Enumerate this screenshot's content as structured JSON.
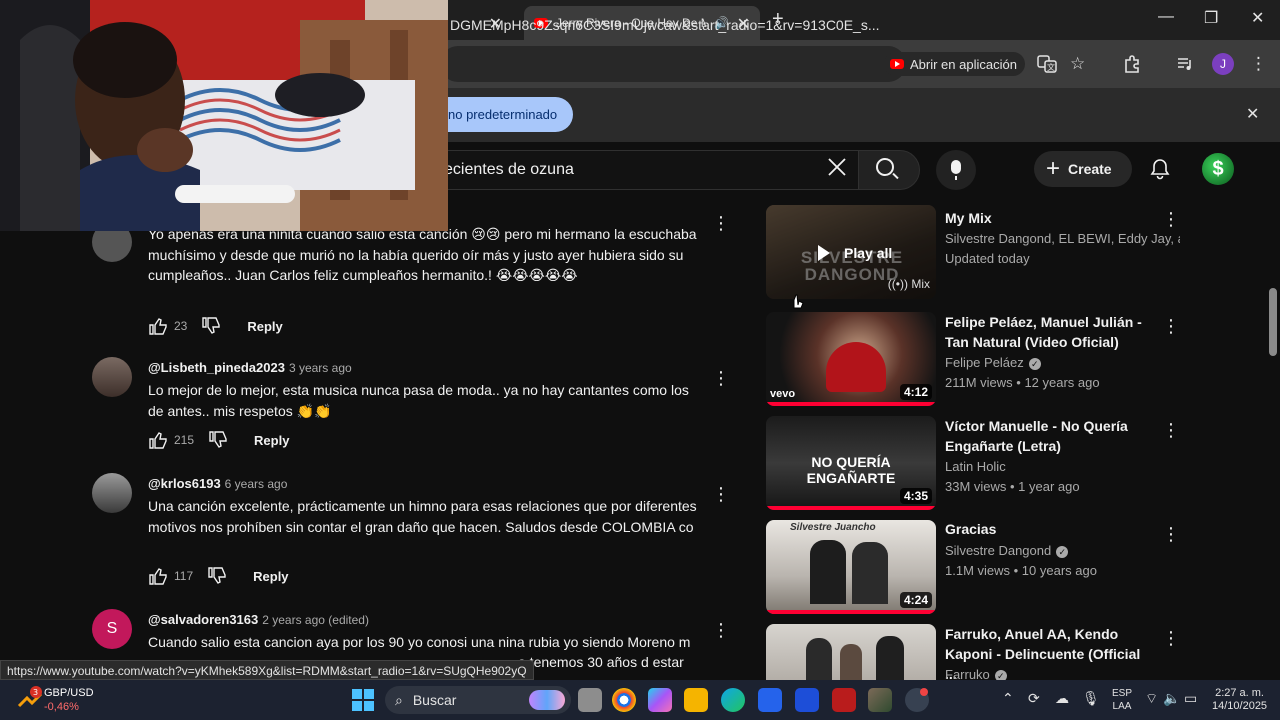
{
  "browser": {
    "tabs": [
      {
        "title": "",
        "active": false
      },
      {
        "title": "Jerry Rivera - Que Hay De Mal",
        "active": true
      }
    ],
    "url": "DGMEMpH8c9Zsqn6C3SI9mUjwcaw&start_radio=1&rv=913C0E_s...",
    "open_in_app_label": "Abrir en aplicación",
    "profile_letter": "J",
    "infobar_button": "no predeterminado",
    "status_url": "https://www.youtube.com/watch?v=yKMhek589Xg&list=RDMM&start_radio=1&rv=SUgQHe902yQ"
  },
  "youtube": {
    "search_query": "ecientes de ozuna",
    "create_label": "Create",
    "avatar_letter": "$"
  },
  "comments": [
    {
      "author": "",
      "time": "",
      "text": "Yo apenas era una niñita cuando salio esta canción 😢😢 pero mi hermano la escuchaba muchísimo y desde que murió no la había querido oír más y justo ayer hubiera sido su cumpleaños.. Juan Carlos feliz cumpleaños hermanito.! 😭😭😭😭😭",
      "likes": "23",
      "reply_label": "Reply"
    },
    {
      "author": "@Lisbeth_pineda2023",
      "time": "3 years ago",
      "text": "Lo mejor de lo mejor, esta musica nunca pasa de moda.. ya no hay cantantes como los de antes.. mis respetos 👏👏",
      "likes": "215",
      "reply_label": "Reply"
    },
    {
      "author": "@krlos6193",
      "time": "6 years ago",
      "text": "Una canción excelente, prácticamente un himno para esas relaciones que por diferentes motivos nos prohíben sin contar el gran daño que hacen. Saludos desde COLOMBIA co",
      "likes": "117",
      "reply_label": "Reply"
    },
    {
      "author": "@salvadoren3163",
      "time": "2 years ago (edited)",
      "avatar_letter": "S",
      "text": "Cuando salio esta cancion aya por los 90 yo conosi una nina rubia yo siendo Moreno m",
      "text2": "a tenemos 30 años d estar"
    }
  ],
  "sidebar": [
    {
      "title": "My Mix",
      "meta1": "Silvestre Dangond, EL BEWI, Eddy Jay, an...",
      "meta2": "Updated today",
      "play_all": "Play all",
      "mix_label": "Mix",
      "thumb_text": "SILVESTRE DANGOND"
    },
    {
      "title": "Felipe Peláez, Manuel Julián - Tan Natural (Video Oficial)",
      "channel": "Felipe Peláez",
      "stats": "211M views • 12 years ago",
      "duration": "4:12",
      "thumb_text": "vevo"
    },
    {
      "title": "Víctor Manuelle - No Quería Engañarte (Letra)",
      "channel": "Latin Holic",
      "stats": "33M views • 1 year ago",
      "duration": "4:35",
      "thumb_text": "NO QUERÍA ENGAÑARTE"
    },
    {
      "title": "Gracias",
      "channel": "Silvestre Dangond",
      "stats": "1.1M views • 10 years ago",
      "duration": "4:24",
      "thumb_text": "Silvestre Juancho"
    },
    {
      "title": "Farruko, Anuel AA, Kendo Kaponi - Delincuente (Official ...",
      "channel": "Farruko"
    }
  ],
  "taskbar": {
    "ticker_symbol": "GBP/USD",
    "ticker_change": "-0,46%",
    "ticker_badge": "3",
    "search_label": "Buscar",
    "lang_line1": "ESP",
    "lang_line2": "LAA",
    "time": "2:27 a. m.",
    "date": "14/10/2025"
  }
}
